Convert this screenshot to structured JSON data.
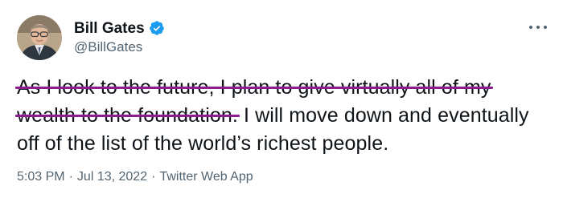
{
  "tweet": {
    "author": {
      "display_name": "Bill Gates",
      "handle": "@BillGates",
      "verified": true
    },
    "text": {
      "struck_part": "As I look to the future, I plan to give virtually all of my wealth to the foundation.",
      "remaining_part": " I will move down and eventually off of the list of the world’s richest people."
    },
    "meta": {
      "time": "5:03 PM",
      "separator": "·",
      "date": "Jul 13, 2022",
      "source": "Twitter Web App"
    }
  },
  "colors": {
    "strike": "#8b1c93",
    "verified": "#1d9bf0",
    "secondary_text": "#536471"
  },
  "icons": {
    "verified": "verified-badge-icon",
    "more": "more-dots-icon"
  }
}
